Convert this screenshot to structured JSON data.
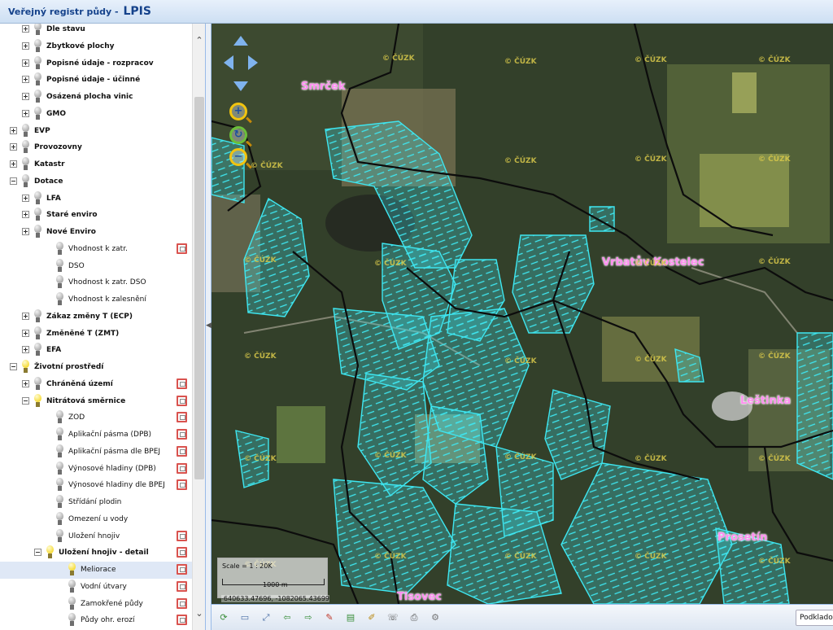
{
  "app": {
    "title": "Veřejný registr půdy - ",
    "brand": "LPIS"
  },
  "tree": [
    {
      "label": "Dle stavu",
      "bold": true,
      "indent": 1,
      "expander": "plus",
      "bulb": "off",
      "legend": false,
      "selected": false
    },
    {
      "label": "Zbytkové plochy",
      "bold": true,
      "indent": 1,
      "expander": "plus",
      "bulb": "off",
      "legend": false,
      "selected": false
    },
    {
      "label": "Popisné údaje - rozpracov",
      "bold": true,
      "indent": 1,
      "expander": "plus",
      "bulb": "off",
      "legend": false,
      "selected": false
    },
    {
      "label": "Popisné údaje - účinné",
      "bold": true,
      "indent": 1,
      "expander": "plus",
      "bulb": "off",
      "legend": false,
      "selected": false
    },
    {
      "label": "Osázená plocha vinic",
      "bold": true,
      "indent": 1,
      "expander": "plus",
      "bulb": "off",
      "legend": false,
      "selected": false
    },
    {
      "label": "GMO",
      "bold": true,
      "indent": 1,
      "expander": "plus",
      "bulb": "off",
      "legend": false,
      "selected": false
    },
    {
      "label": "EVP",
      "bold": true,
      "indent": 0,
      "expander": "plus",
      "bulb": "off",
      "legend": false,
      "selected": false
    },
    {
      "label": "Provozovny",
      "bold": true,
      "indent": 0,
      "expander": "plus",
      "bulb": "off",
      "legend": false,
      "selected": false
    },
    {
      "label": "Katastr",
      "bold": true,
      "indent": 0,
      "expander": "plus",
      "bulb": "off",
      "legend": false,
      "selected": false
    },
    {
      "label": "Dotace",
      "bold": true,
      "indent": 0,
      "expander": "minus",
      "bulb": "off",
      "legend": false,
      "selected": false
    },
    {
      "label": "LFA",
      "bold": true,
      "indent": 1,
      "expander": "plus",
      "bulb": "off",
      "legend": false,
      "selected": false
    },
    {
      "label": "Staré enviro",
      "bold": true,
      "indent": 1,
      "expander": "plus",
      "bulb": "off",
      "legend": false,
      "selected": false
    },
    {
      "label": "Nové Enviro",
      "bold": true,
      "indent": 1,
      "expander": "plus",
      "bulb": "off",
      "legend": false,
      "selected": false
    },
    {
      "label": "Vhodnost k zatr.",
      "bold": false,
      "indent": 2,
      "expander": "none",
      "bulb": "off",
      "legend": true,
      "selected": false
    },
    {
      "label": "DSO",
      "bold": false,
      "indent": 2,
      "expander": "none",
      "bulb": "off",
      "legend": false,
      "selected": false
    },
    {
      "label": "Vhodnost k zatr. DSO",
      "bold": false,
      "indent": 2,
      "expander": "none",
      "bulb": "off",
      "legend": false,
      "selected": false
    },
    {
      "label": "Vhodnost k zalesnění",
      "bold": false,
      "indent": 2,
      "expander": "none",
      "bulb": "off",
      "legend": false,
      "selected": false
    },
    {
      "label": "Zákaz změny T (ECP)",
      "bold": true,
      "indent": 1,
      "expander": "plus",
      "bulb": "off",
      "legend": false,
      "selected": false
    },
    {
      "label": "Změněné T (ZMT)",
      "bold": true,
      "indent": 1,
      "expander": "plus",
      "bulb": "off",
      "legend": false,
      "selected": false
    },
    {
      "label": "EFA",
      "bold": true,
      "indent": 1,
      "expander": "plus",
      "bulb": "off",
      "legend": false,
      "selected": false
    },
    {
      "label": "Životní prostředí",
      "bold": true,
      "indent": 0,
      "expander": "minus",
      "bulb": "on",
      "legend": false,
      "selected": false
    },
    {
      "label": "Chráněná území",
      "bold": true,
      "indent": 1,
      "expander": "plus",
      "bulb": "off",
      "legend": true,
      "selected": false
    },
    {
      "label": "Nitrátová směrnice",
      "bold": true,
      "indent": 1,
      "expander": "minus",
      "bulb": "on",
      "legend": true,
      "selected": false
    },
    {
      "label": "ZOD",
      "bold": false,
      "indent": 2,
      "expander": "none",
      "bulb": "off",
      "legend": true,
      "selected": false
    },
    {
      "label": "Aplikační pásma (DPB)",
      "bold": false,
      "indent": 2,
      "expander": "none",
      "bulb": "off",
      "legend": true,
      "selected": false
    },
    {
      "label": "Aplikační pásma dle BPEJ",
      "bold": false,
      "indent": 2,
      "expander": "none",
      "bulb": "off",
      "legend": true,
      "selected": false
    },
    {
      "label": "Výnosové hladiny (DPB)",
      "bold": false,
      "indent": 2,
      "expander": "none",
      "bulb": "off",
      "legend": true,
      "selected": false
    },
    {
      "label": "Výnosové hladiny dle BPEJ",
      "bold": false,
      "indent": 2,
      "expander": "none",
      "bulb": "off",
      "legend": true,
      "selected": false
    },
    {
      "label": "Střídání plodin",
      "bold": false,
      "indent": 2,
      "expander": "none",
      "bulb": "off",
      "legend": false,
      "selected": false
    },
    {
      "label": "Omezení u vody",
      "bold": false,
      "indent": 2,
      "expander": "none",
      "bulb": "off",
      "legend": false,
      "selected": false
    },
    {
      "label": "Uložení hnojiv",
      "bold": false,
      "indent": 2,
      "expander": "none",
      "bulb": "off",
      "legend": true,
      "selected": false
    },
    {
      "label": "Uložení hnojiv - detail",
      "bold": true,
      "indent": 2,
      "expander": "minus",
      "bulb": "on",
      "legend": true,
      "selected": false
    },
    {
      "label": "Meliorace",
      "bold": false,
      "indent": 3,
      "expander": "none",
      "bulb": "on",
      "legend": true,
      "selected": true
    },
    {
      "label": "Vodní útvary",
      "bold": false,
      "indent": 3,
      "expander": "none",
      "bulb": "off",
      "legend": true,
      "selected": false
    },
    {
      "label": "Zamokřené půdy",
      "bold": false,
      "indent": 3,
      "expander": "none",
      "bulb": "off",
      "legend": true,
      "selected": false
    },
    {
      "label": "Půdy ohr. erozí",
      "bold": false,
      "indent": 3,
      "expander": "none",
      "bulb": "off",
      "legend": true,
      "selected": false
    }
  ],
  "map": {
    "places": [
      "Smrček",
      "Vrbatův Kostelec",
      "Leštinka",
      "Prosetín",
      "Tisovec"
    ],
    "watermark": "© ČÚZK",
    "scale_text": "Scale = 1 : 20K",
    "scale_bar_label": "1000 m",
    "coords": "-640633.47696, -1082065.43699",
    "zoom_in_label": "+",
    "zoom_out_label": "−",
    "zoom_reset_label": "↻"
  },
  "toolbar": {
    "tools": [
      "refresh-icon",
      "screen-icon",
      "zoom-extent-icon",
      "back-icon",
      "forward-icon",
      "ruler-icon",
      "layers-icon",
      "brush-icon",
      "phone-icon",
      "print-icon",
      "settings-icon"
    ],
    "tool_glyphs": [
      "⟳",
      "▭",
      "⤢",
      "⇦",
      "⇨",
      "✎",
      "▤",
      "✐",
      "☏",
      "⎙",
      "⚙"
    ],
    "basemap_label": "Podkladov"
  },
  "colors": {
    "header": "#15428b",
    "parcel": "#3ee6f0",
    "place": "#ff8ff0",
    "border": "#111111"
  }
}
